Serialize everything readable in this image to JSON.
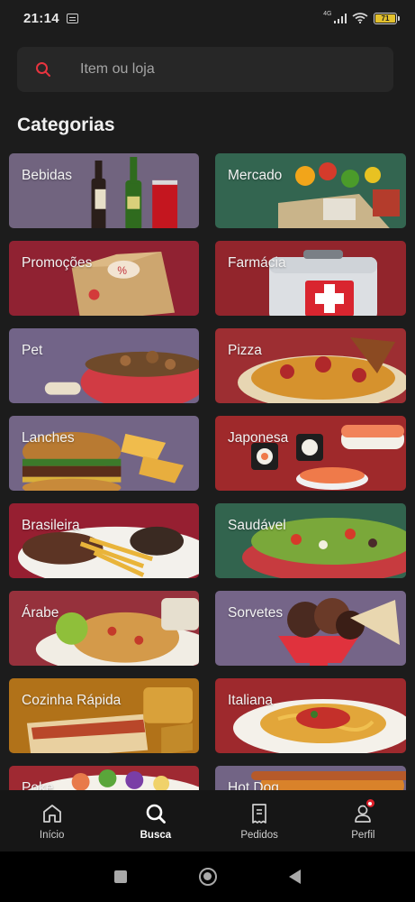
{
  "status_bar": {
    "time": "21:14",
    "network": "4G",
    "battery": "71"
  },
  "search": {
    "placeholder": "Item ou loja"
  },
  "categories": {
    "title": "Categorias",
    "items": [
      {
        "label": "Bebidas",
        "color": "#8a7a9b",
        "art": "drinks"
      },
      {
        "label": "Mercado",
        "color": "#3f7c62",
        "art": "market"
      },
      {
        "label": "Promoções",
        "color": "#b02a3e",
        "art": "promo"
      },
      {
        "label": "Farmácia",
        "color": "#b32e36",
        "art": "pharmacy"
      },
      {
        "label": "Pet",
        "color": "#8b7aa6",
        "art": "pet"
      },
      {
        "label": "Pizza",
        "color": "#c0393d",
        "art": "pizza"
      },
      {
        "label": "Lanches",
        "color": "#8d7ca4",
        "art": "burger"
      },
      {
        "label": "Japonesa",
        "color": "#c23235",
        "art": "sushi"
      },
      {
        "label": "Brasileira",
        "color": "#b8273c",
        "art": "brasileira"
      },
      {
        "label": "Saudável",
        "color": "#3d7a60",
        "art": "salad"
      },
      {
        "label": "Árabe",
        "color": "#b83c4a",
        "art": "arabe"
      },
      {
        "label": "Sorvetes",
        "color": "#8f7ca6",
        "art": "icecream"
      },
      {
        "label": "Cozinha Rápida",
        "color": "#d88b1f",
        "art": "fast"
      },
      {
        "label": "Italiana",
        "color": "#c13238",
        "art": "pasta"
      },
      {
        "label": "Poke",
        "color": "#c2323d",
        "art": "poke"
      },
      {
        "label": "Hot Dog",
        "color": "#8b7aa3",
        "art": "hotdog"
      }
    ]
  },
  "bottom_nav": {
    "items": [
      {
        "label": "Início",
        "icon": "home-icon"
      },
      {
        "label": "Busca",
        "icon": "search-icon",
        "active": true
      },
      {
        "label": "Pedidos",
        "icon": "receipt-icon"
      },
      {
        "label": "Perfil",
        "icon": "profile-icon",
        "badge": true
      }
    ]
  },
  "colors": {
    "background": "#1c1c1c",
    "accent": "#ea1d2c",
    "search_bg": "#272727"
  }
}
